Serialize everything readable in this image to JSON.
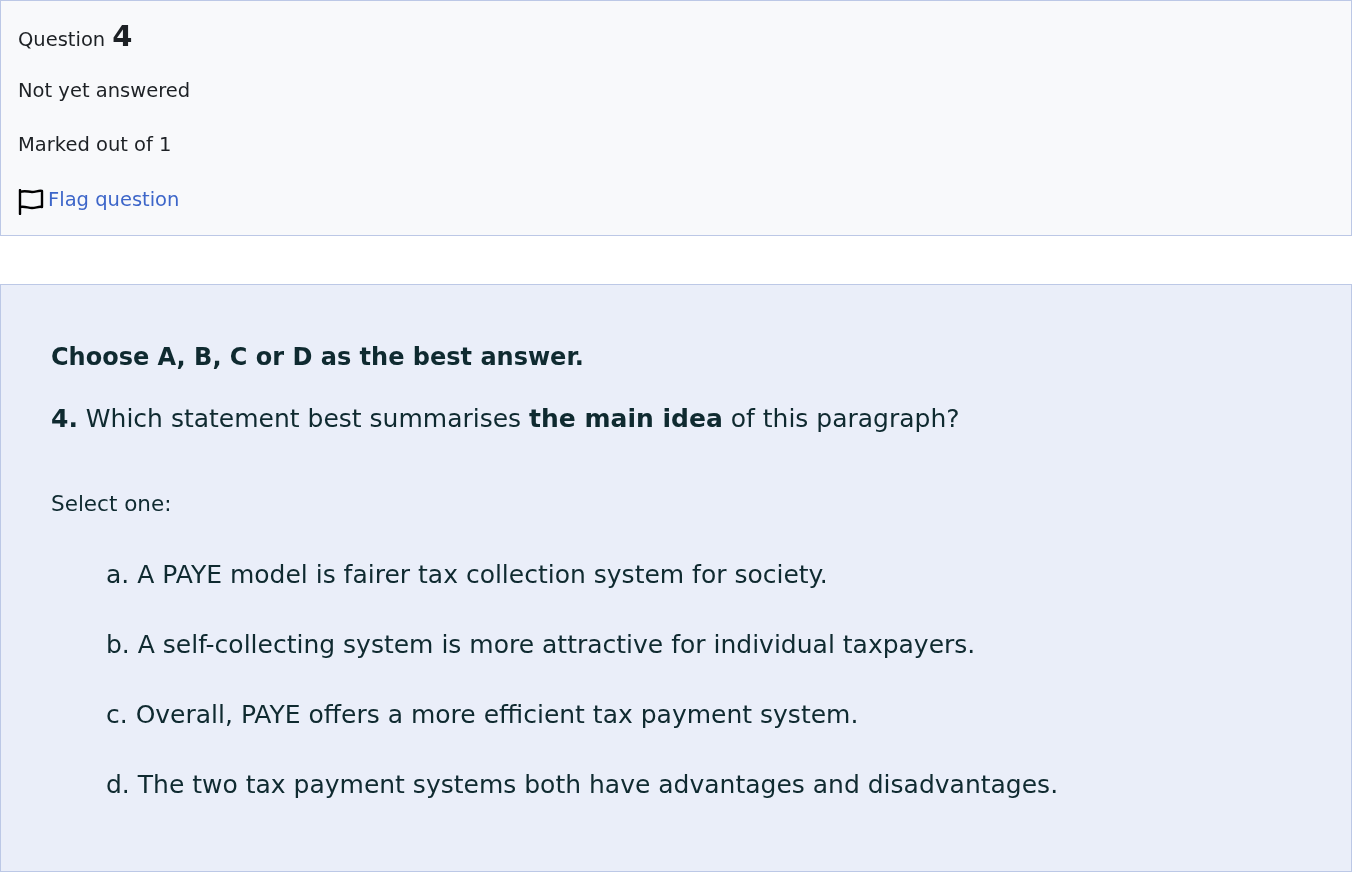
{
  "info": {
    "question_label": "Question",
    "question_number": "4",
    "state": "Not yet answered",
    "grade": "Marked out of 1",
    "flag_link": "Flag question"
  },
  "content": {
    "instruction": "Choose A, B, C or D as the best answer.",
    "question": "**4.** Which statement best summarises **the main idea** of this paragraph?",
    "prompt": "Select one:",
    "options": [
      "a. A PAYE model is fairer tax collection system for society.",
      "b. A self-collecting system is more attractive for individual taxpayers.",
      "c. Overall, PAYE offers a more efficient tax payment system.",
      "d. The two tax payment systems both have advantages and disadvantages."
    ]
  }
}
